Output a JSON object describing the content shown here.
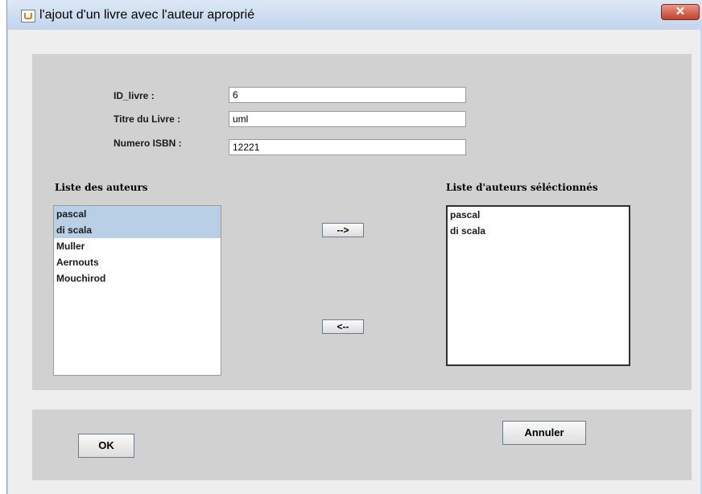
{
  "window": {
    "title": "l'ajout d'un livre avec l'auteur aproprié",
    "close_label": "✕"
  },
  "form": {
    "id_label": "ID_livre :",
    "id_value": "6",
    "title_label": "Titre du Livre :",
    "title_value": "uml",
    "isbn_label": "Numero ISBN :",
    "isbn_value": "12221"
  },
  "authors": {
    "left_title": "Liste des auteurs",
    "right_title": "Liste d'auteurs séléctionnés",
    "available": [
      "pascal",
      "di scala",
      "Muller",
      "Aernouts",
      "Mouchirod"
    ],
    "selected": [
      "pascal",
      "di scala"
    ]
  },
  "buttons": {
    "add": "-->",
    "remove": "<--",
    "ok": "OK",
    "cancel": "Annuler"
  }
}
